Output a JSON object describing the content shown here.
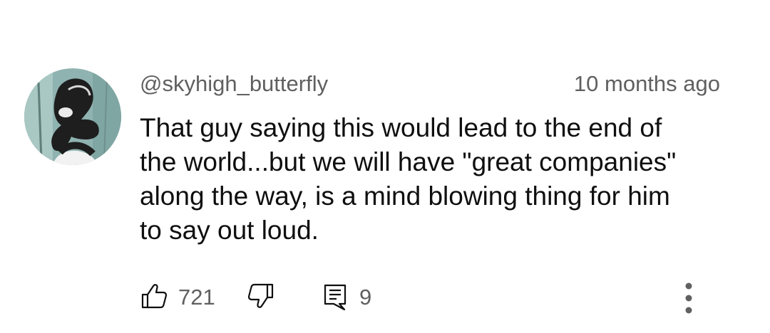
{
  "comment": {
    "author": "@skyhigh_butterfly",
    "timestamp": "10 months ago",
    "text_lines": [
      "That guy saying this would lead to the end of",
      "the world...but we will have \"great companies\"",
      "along the way, is a mind blowing thing for him",
      "to say out loud."
    ],
    "likes": "721",
    "replies": "9"
  },
  "icons": {
    "like": "thumbs-up-icon",
    "dislike": "thumbs-down-icon",
    "reply": "reply-comment-icon",
    "more": "more-vertical-icon"
  },
  "colors": {
    "primary_text": "#0f0f0f",
    "secondary_text": "#606060"
  }
}
